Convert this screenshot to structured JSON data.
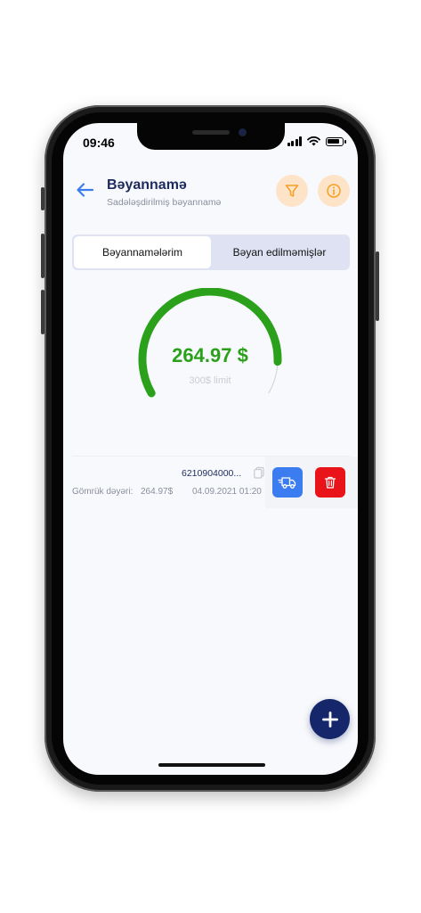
{
  "status_bar": {
    "time": "09:46"
  },
  "header": {
    "title": "Bəyannamə",
    "subtitle": "Sadələşdirilmiş bəyannamə"
  },
  "icons": {
    "back": "arrow-left-icon",
    "filter": "filter-icon",
    "info": "info-icon",
    "copy": "copy-icon",
    "ship": "truck-icon",
    "delete": "trash-icon",
    "add": "plus-icon"
  },
  "tabs": [
    {
      "label": "Bəyannamələrim",
      "active": true
    },
    {
      "label": "Bəyan edilməmişlər",
      "active": false
    }
  ],
  "gauge": {
    "value_text": "264.97 $",
    "limit_text": "300$ limit",
    "value": 264.97,
    "limit": 300
  },
  "declaration": {
    "number": "6210904000...",
    "customs_label": "Gömrük dəyəri:",
    "customs_value": "264.97$",
    "date": "04.09.2021 01:20"
  },
  "colors": {
    "accent": "#2ba11b",
    "primary": "#1c2a5e",
    "ship_button": "#3b7df0",
    "delete_button": "#e8141a",
    "icon_button_bg": "#fde3c8",
    "icon_button_fg": "#f4a024"
  }
}
